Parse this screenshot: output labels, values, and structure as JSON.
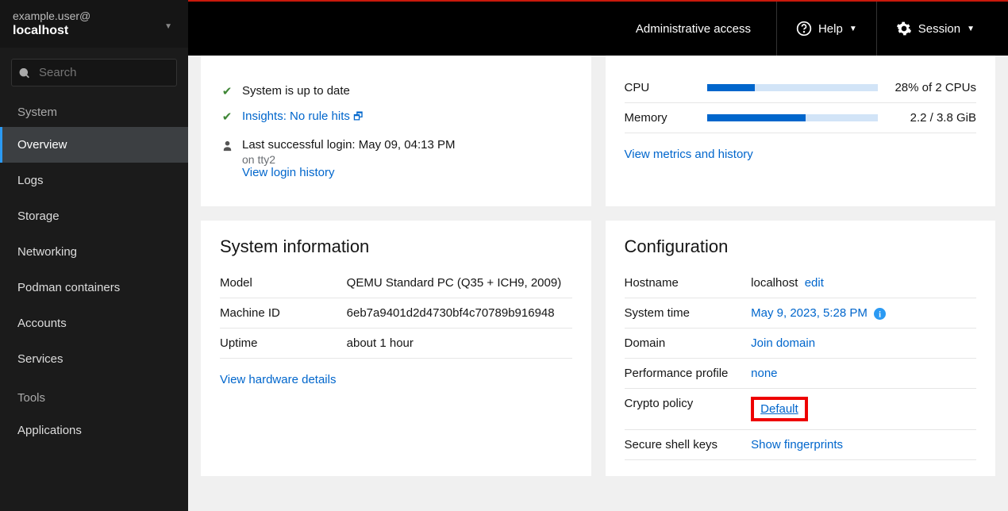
{
  "header": {
    "user": "example.user@",
    "host": "localhost",
    "search_placeholder": "Search",
    "admin_access": "Administrative access",
    "help": "Help",
    "session": "Session"
  },
  "nav": {
    "group1_label": "System",
    "items": [
      "Overview",
      "Logs",
      "Storage",
      "Networking",
      "Podman containers",
      "Accounts",
      "Services"
    ],
    "group2_label": "Tools",
    "tools": [
      "Applications"
    ]
  },
  "health": {
    "uptodate": "System is up to date",
    "insights": "Insights: No rule hits",
    "last_login_label": "Last successful login: May 09, 04:13 PM",
    "last_login_sub": "on tty2",
    "login_history": "View login history"
  },
  "usage": {
    "cpu_label": "CPU",
    "cpu_value": "28% of 2 CPUs",
    "cpu_pct": 28,
    "mem_label": "Memory",
    "mem_value": "2.2 / 3.8 GiB",
    "mem_pct": 58,
    "metrics_link": "View metrics and history"
  },
  "sysinfo": {
    "title": "System information",
    "rows": [
      {
        "k": "Model",
        "v": "QEMU Standard PC (Q35 + ICH9, 2009)"
      },
      {
        "k": "Machine ID",
        "v": "6eb7a9401d2d4730bf4c70789b916948"
      },
      {
        "k": "Uptime",
        "v": "about 1 hour"
      }
    ],
    "hw_link": "View hardware details"
  },
  "config": {
    "title": "Configuration",
    "hostname_k": "Hostname",
    "hostname_v": "localhost",
    "hostname_edit": "edit",
    "systime_k": "System time",
    "systime_v": "May 9, 2023, 5:28 PM",
    "domain_k": "Domain",
    "domain_v": "Join domain",
    "perf_k": "Performance profile",
    "perf_v": "none",
    "crypto_k": "Crypto policy",
    "crypto_v": "Default",
    "ssh_k": "Secure shell keys",
    "ssh_v": "Show fingerprints"
  }
}
